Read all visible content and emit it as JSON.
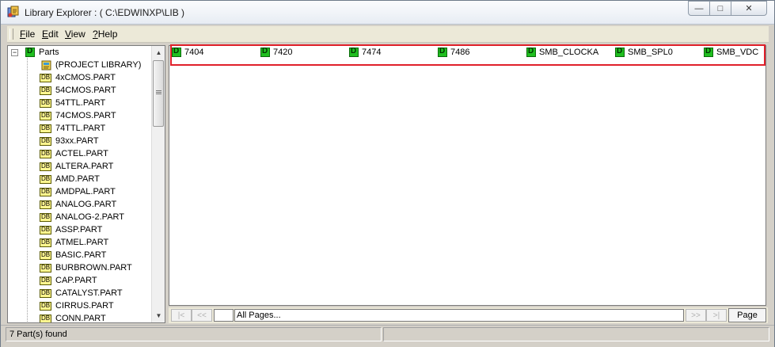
{
  "window": {
    "title": "Library Explorer : ( C:\\EDWINXP\\LIB )",
    "controls": {
      "minimize": "—",
      "maximize": "□",
      "close": "✕"
    }
  },
  "menu": [
    {
      "label_first": "F",
      "label_rest": "ile"
    },
    {
      "label_first": "E",
      "label_rest": "dit"
    },
    {
      "label_first": "V",
      "label_rest": "iew"
    },
    {
      "label_first": "?",
      "label_rest": "Help"
    }
  ],
  "tree": {
    "expander": "−",
    "root": "Parts",
    "project_library": "(PROJECT LIBRARY)",
    "items": [
      "4xCMOS.PART",
      "54CMOS.PART",
      "54TTL.PART",
      "74CMOS.PART",
      "74TTL.PART",
      "93xx.PART",
      "ACTEL.PART",
      "ALTERA.PART",
      "AMD.PART",
      "AMDPAL.PART",
      "ANALOG.PART",
      "ANALOG-2.PART",
      "ASSP.PART",
      "ATMEL.PART",
      "BASIC.PART",
      "BURBROWN.PART",
      "CAP.PART",
      "CATALYST.PART",
      "CIRRUS.PART",
      "CONN.PART"
    ]
  },
  "parts": [
    "7404",
    "7420",
    "7474",
    "7486",
    "SMB_CLOCKA",
    "SMB_SPL0",
    "SMB_VDC"
  ],
  "pager": {
    "first": "|<",
    "prev": "<<",
    "next": ">>",
    "last": ">|",
    "field": "All Pages...",
    "page_button": "Page"
  },
  "status": {
    "text": "7 Part(s) found"
  },
  "colors": {
    "highlight": "#e0202a",
    "part_icon": "#1fbf1f",
    "tree_icon": "#fff68f"
  }
}
